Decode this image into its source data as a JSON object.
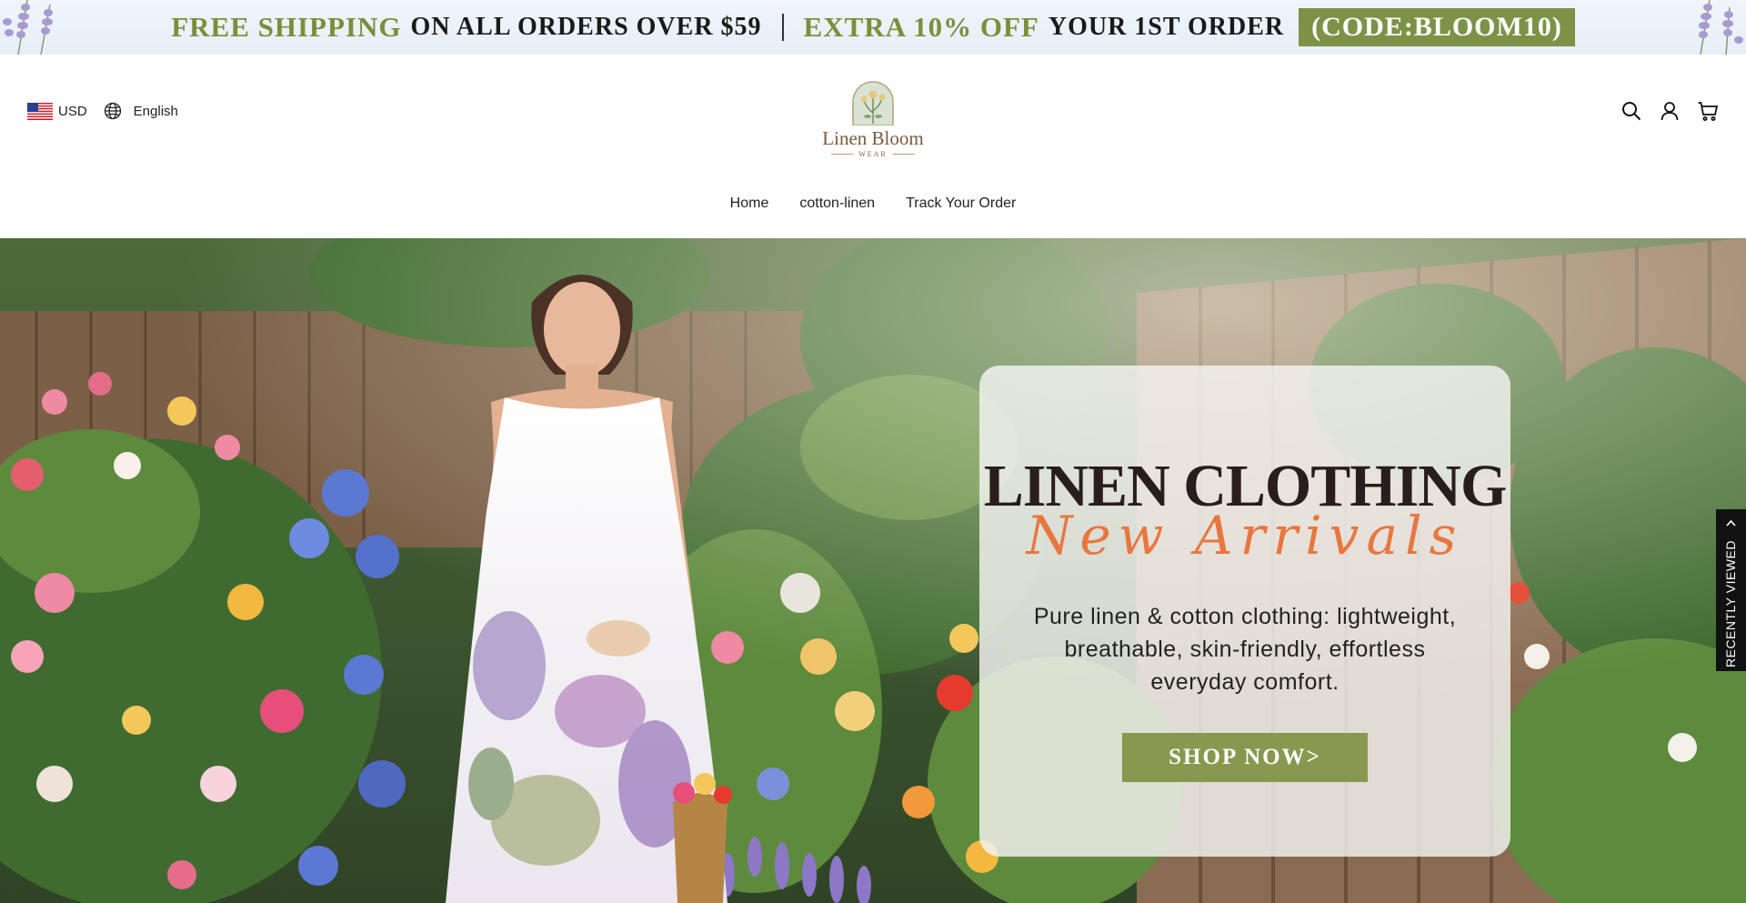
{
  "announcement": {
    "part1_highlight": "FREE SHIPPING",
    "part1_rest": "ON ALL ORDERS OVER $59",
    "part2_highlight": "EXTRA 10% OFF",
    "part2_rest": "YOUR 1ST ORDER",
    "code": "(CODE:BLOOM10)"
  },
  "header": {
    "currency": "USD",
    "language": "English",
    "logo": {
      "name": "Linen Bloom",
      "tagline": "WEAR"
    },
    "icons": [
      "search-icon",
      "account-icon",
      "cart-icon"
    ]
  },
  "nav": {
    "items": [
      {
        "label": "Home"
      },
      {
        "label": "cotton-linen"
      },
      {
        "label": "Track Your Order"
      }
    ]
  },
  "hero": {
    "title": "LINEN CLOTHING",
    "subtitle": "New Arrivals",
    "description": "Pure linen & cotton clothing: lightweight, breathable, skin-friendly, effortless everyday comfort.",
    "cta_label": "SHOP NOW>"
  },
  "recently_viewed": {
    "label": "RECENTLY VIEWED"
  },
  "colors": {
    "accent_green": "#86994f",
    "announcement_green": "#7a8f3a",
    "subtitle_orange": "#e8773f",
    "title_dark": "#2a1d1d"
  }
}
